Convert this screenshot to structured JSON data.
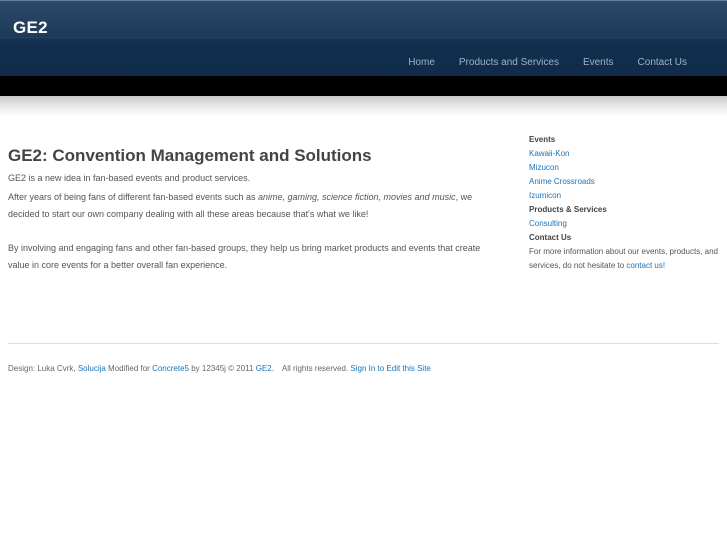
{
  "header": {
    "site_title": "GE2",
    "nav": [
      "Home",
      "Products and Services",
      "Events",
      "Contact Us"
    ]
  },
  "main": {
    "title": "GE2: Convention Management and Solutions",
    "intro": "GE2 is a new idea in fan-based events and product services.",
    "para1_before": "After years of being fans of different fan-based events such as ",
    "para1_topics": "anime, gaming, science fiction, movies and music",
    "para1_after": ", we decided to start our own company dealing with all these areas because that's what we like!",
    "para2": "By involving and engaging fans and other fan-based groups, they help us bring market products and events that create value in core events for a better overall fan experience."
  },
  "sidebar": {
    "events_heading": "Events",
    "events": [
      "Kawaii-Kon",
      "Mizucon",
      "Anime Crossroads",
      "Izumicon"
    ],
    "products_heading": "Products & Services",
    "products": [
      "Consulting"
    ],
    "contact_heading": "Contact Us",
    "contact_text": "For more information about our events, products, and services, do not hesitate to ",
    "contact_link": "contact us!"
  },
  "footer": {
    "design_prefix": "Design: Luka Cvrk, ",
    "design_link": "Solucija",
    "modified_text": " Modified for ",
    "concrete_link": "Concrete5",
    "copyright_text": " by 12345j © 2011 ",
    "site_link": "GE2.",
    "rights_text": "All rights reserved. ",
    "sign_in_link": "Sign In to Edit this Site"
  },
  "colors": {
    "header_bg": "#1f3b5a",
    "link": "#1a74b8",
    "nav_text": "#9db3c9"
  }
}
